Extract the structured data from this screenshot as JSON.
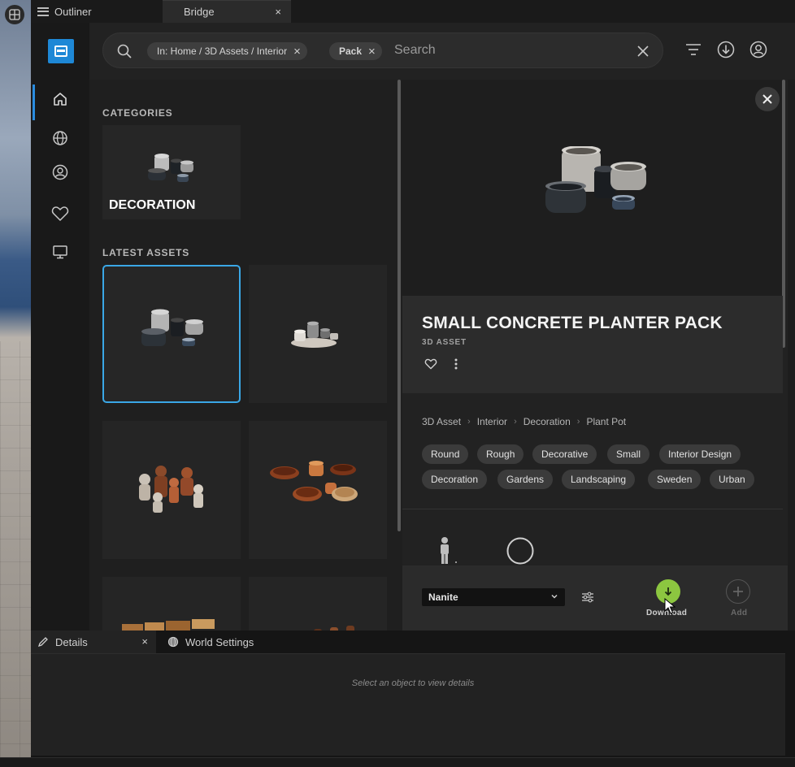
{
  "tabs": {
    "outliner": "Outliner",
    "bridge": "Bridge",
    "close": "×"
  },
  "search": {
    "chips": [
      "In: Home / 3D Assets / Interior",
      "Pack"
    ],
    "placeholder": "Search"
  },
  "sidebar": {
    "items": [
      "home-icon",
      "globe-icon",
      "user-icon",
      "heart-icon",
      "monitor-icon"
    ]
  },
  "categories": {
    "title": "CATEGORIES",
    "items": [
      "DECORATION"
    ]
  },
  "latest": {
    "title": "LATEST ASSETS"
  },
  "asset": {
    "title": "SMALL CONCRETE PLANTER PACK",
    "type": "3D ASSET",
    "breadcrumb": [
      "3D Asset",
      "Interior",
      "Decoration",
      "Plant Pot"
    ],
    "tags": [
      "Round",
      "Rough",
      "Decorative",
      "Small",
      "Interior Design",
      "Decoration",
      "Gardens",
      "Landscaping",
      "Sweden",
      "Urban"
    ]
  },
  "actions": {
    "quality": "Nanite",
    "download": "Download",
    "add": "Add"
  },
  "details_panel": {
    "tab_details": "Details",
    "tab_world": "World Settings",
    "empty": "Select an object to view details"
  },
  "colors": {
    "accent": "#2a8ce0",
    "download": "#8cc640",
    "selection": "#3aa7e6"
  }
}
